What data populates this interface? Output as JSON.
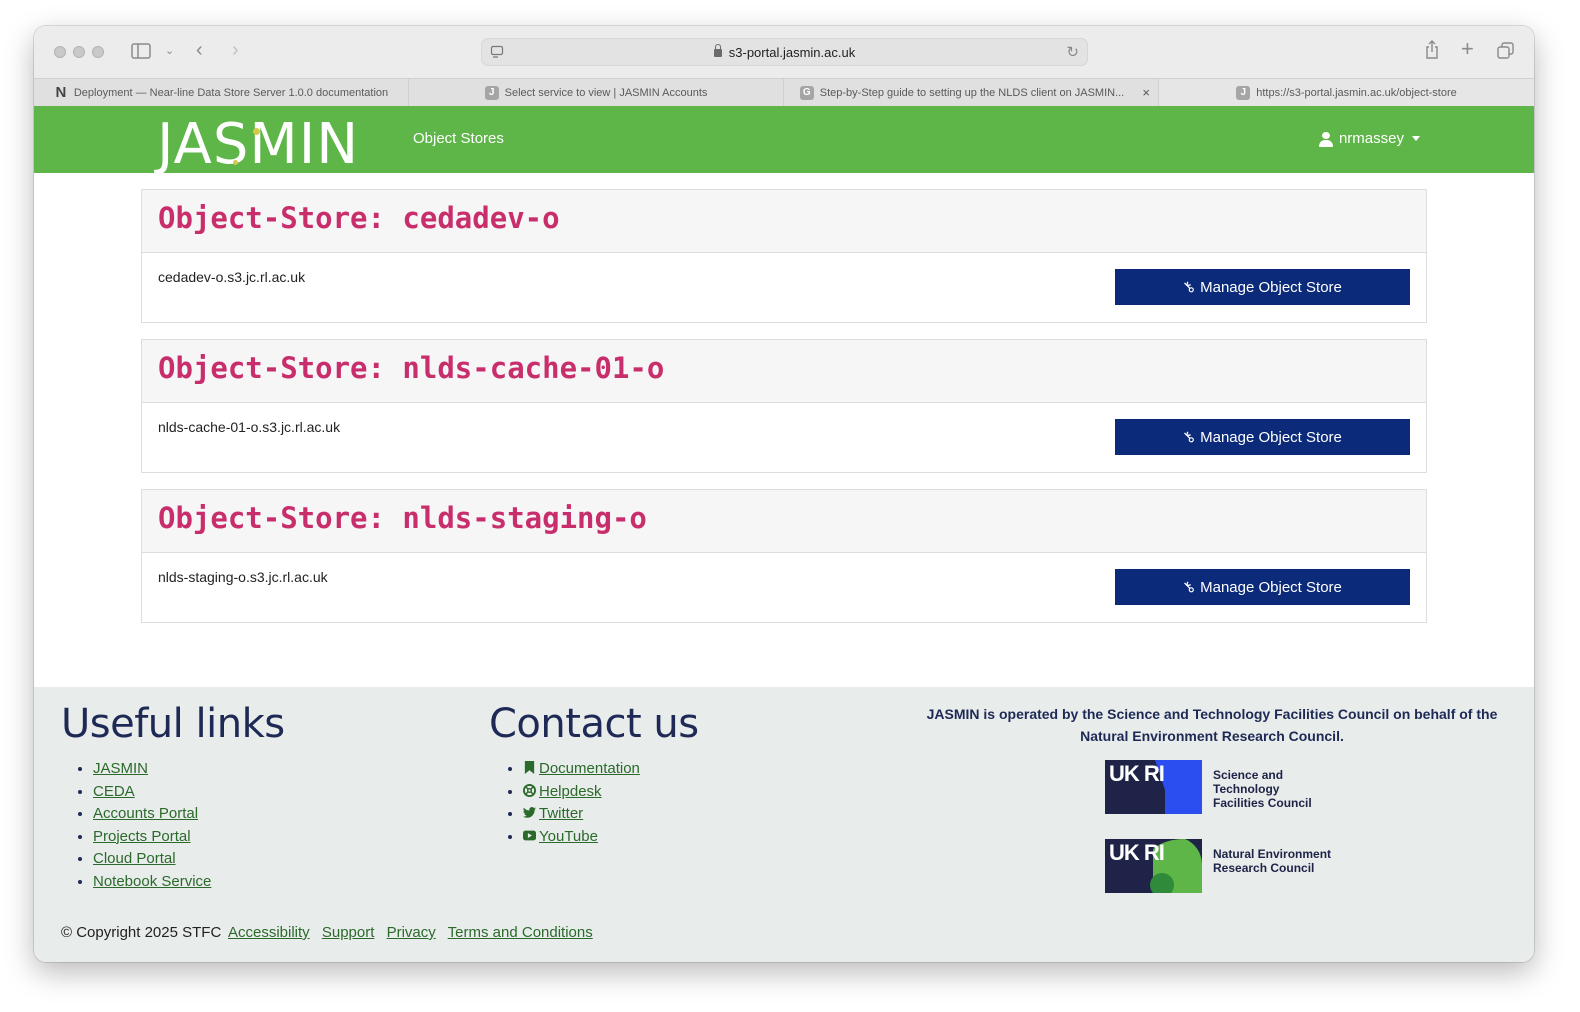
{
  "browser": {
    "url": "s3-portal.jasmin.ac.uk",
    "tabs": [
      {
        "favicon": "N",
        "title": "Deployment — Near-line Data Store Server 1.0.0 documentation"
      },
      {
        "favicon": "J",
        "title": "Select service to view | JASMIN Accounts"
      },
      {
        "favicon": "G",
        "title": "Step-by-Step guide to setting up the NLDS client on JASMIN..."
      },
      {
        "favicon": "J",
        "title": "https://s3-portal.jasmin.ac.uk/object-store"
      }
    ],
    "close_glyph": "×"
  },
  "header": {
    "logo_text": "JASMIN",
    "nav_label": "Object Stores",
    "username": "nrmassey"
  },
  "stores": [
    {
      "title": "Object-Store: cedadev-o",
      "host": "cedadev-o.s3.jc.rl.ac.uk",
      "button": "Manage Object Store"
    },
    {
      "title": "Object-Store: nlds-cache-01-o",
      "host": "nlds-cache-01-o.s3.jc.rl.ac.uk",
      "button": "Manage Object Store"
    },
    {
      "title": "Object-Store: nlds-staging-o",
      "host": "nlds-staging-o.s3.jc.rl.ac.uk",
      "button": "Manage Object Store"
    }
  ],
  "footer": {
    "useful_heading": "Useful links",
    "useful_links": [
      "JASMIN",
      "CEDA",
      "Accounts Portal",
      "Projects Portal",
      "Cloud Portal",
      "Notebook Service"
    ],
    "contact_heading": "Contact us",
    "contact_links": [
      {
        "icon": "bookmark-icon",
        "label": "Documentation"
      },
      {
        "icon": "lifering-icon",
        "label": "Helpdesk"
      },
      {
        "icon": "twitter-icon",
        "label": "Twitter"
      },
      {
        "icon": "youtube-icon",
        "label": "YouTube"
      }
    ],
    "operated_text": "JASMIN is operated by the Science and Technology Facilities Council on behalf of the Natural Environment Research Council.",
    "ukri_text": "UK RI",
    "stfc_text": "Science and Technology Facilities Council",
    "nerc_text": "Natural Environment Research Council",
    "copyright": "© Copyright 2025 STFC",
    "bottom_links": [
      "Accessibility",
      "Support",
      "Privacy",
      "Terms and Conditions"
    ]
  },
  "colors": {
    "brand_green": "#5db647",
    "button_navy": "#0c2a7a",
    "title_pink": "#c92e6c",
    "link_green": "#2b6a2b",
    "stfc_blue": "#2a4ef0",
    "nerc_green": "#5db647"
  }
}
